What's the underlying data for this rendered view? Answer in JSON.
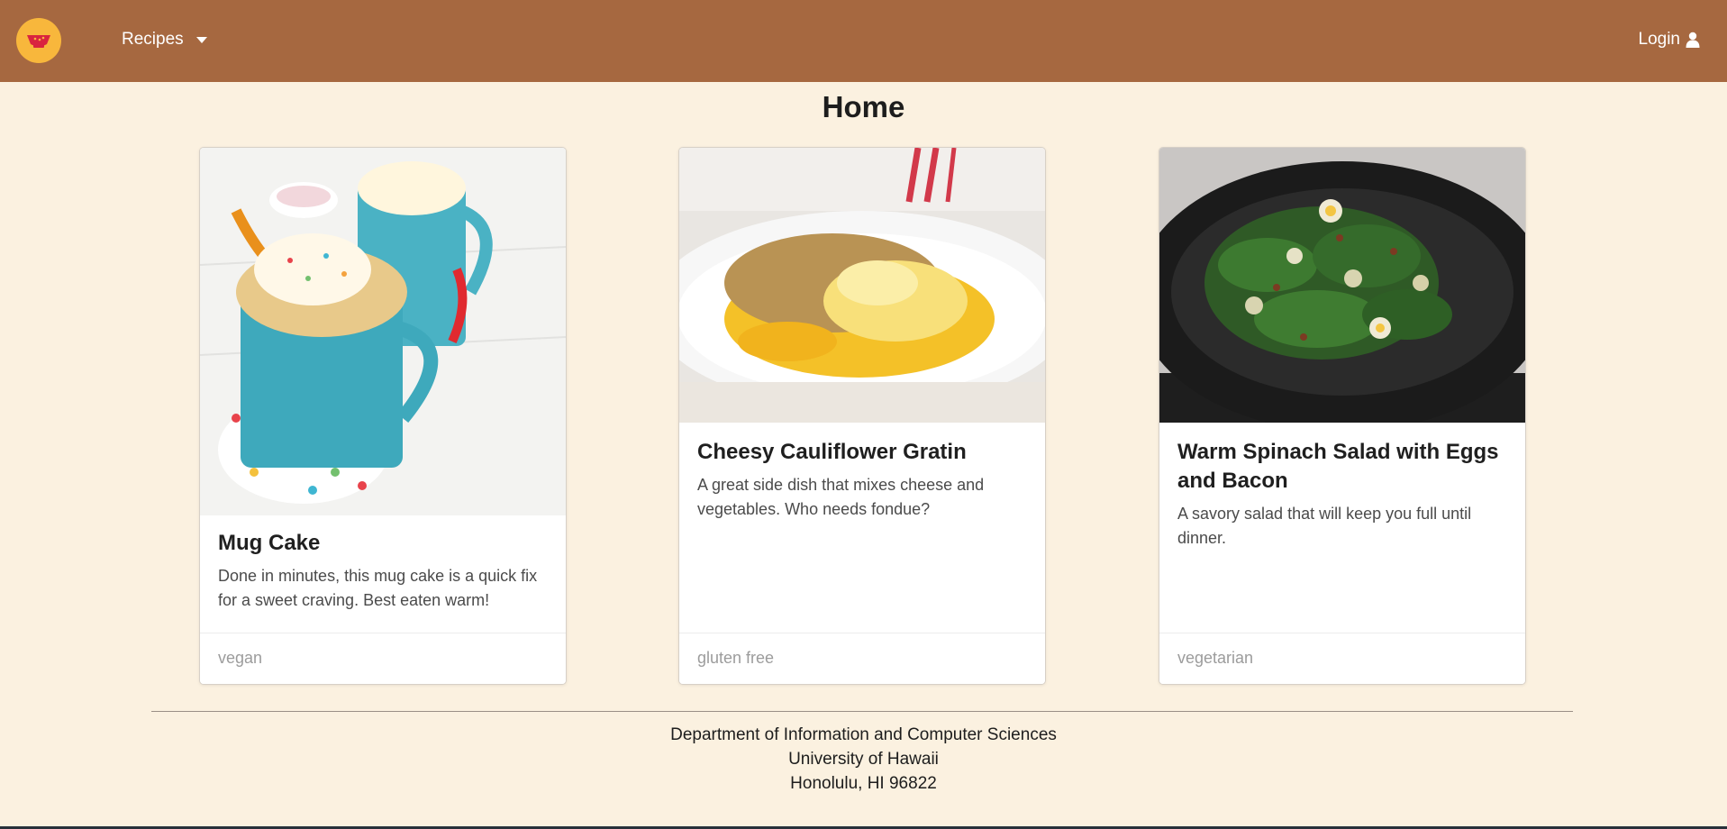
{
  "nav": {
    "logo_icon": "bowl-logo-icon",
    "recipes_label": "Recipes",
    "login_label": "Login",
    "login_icon": "user-icon",
    "colors": {
      "navbar": "#a66840",
      "logo": "#f8b73c",
      "page_bg": "#fbf1e0"
    }
  },
  "page": {
    "title": "Home"
  },
  "cards": [
    {
      "title": "Mug Cake",
      "description": "Done in minutes, this mug cake is a quick fix for a sweet craving. Best eaten warm!",
      "tag": "vegan"
    },
    {
      "title": "Cheesy Cauliflower Gratin",
      "description": "A great side dish that mixes cheese and vegetables. Who needs fondue?",
      "tag": "gluten free"
    },
    {
      "title": "Warm Spinach Salad with Eggs and Bacon",
      "description": "A savory salad that will keep you full until dinner.",
      "tag": "vegetarian"
    }
  ],
  "footer": {
    "line1": "Department of Information and Computer Sciences",
    "line2": "University of Hawaii",
    "line3": "Honolulu, HI 96822"
  }
}
